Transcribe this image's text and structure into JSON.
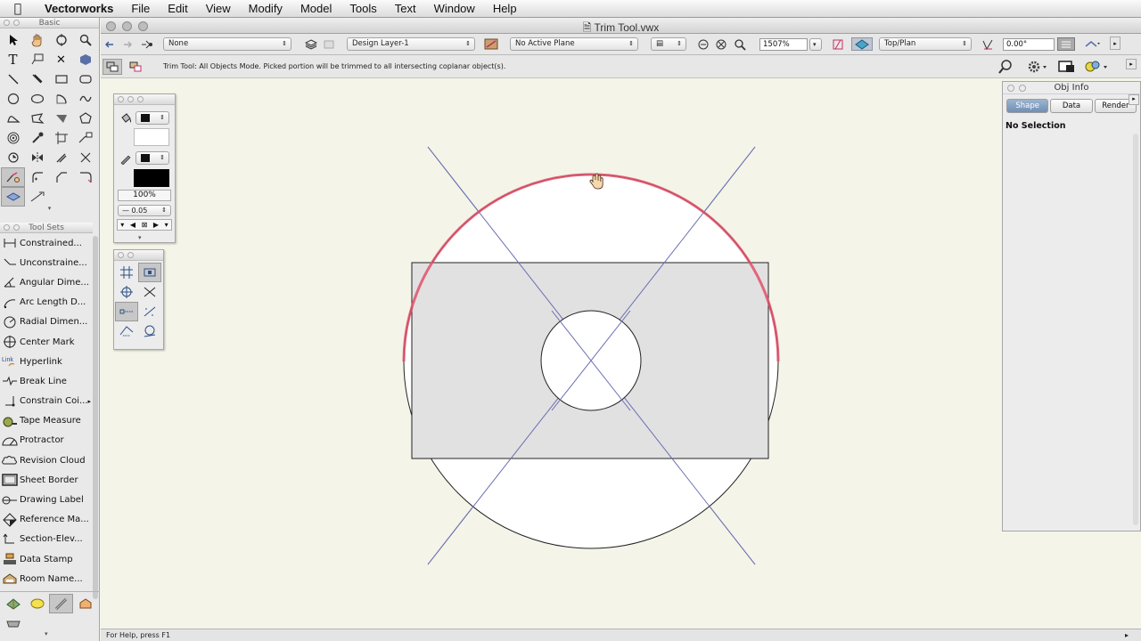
{
  "menubar": {
    "app": "Vectorworks",
    "items": [
      "File",
      "Edit",
      "View",
      "Modify",
      "Model",
      "Tools",
      "Text",
      "Window",
      "Help"
    ]
  },
  "palettes": {
    "basic_title": "Basic",
    "toolsets_title": "Tool Sets",
    "toolset_items": [
      {
        "label": "Constrained...",
        "icon": "constrained-dimension-icon"
      },
      {
        "label": "Unconstraine...",
        "icon": "unconstrained-dimension-icon"
      },
      {
        "label": "Angular Dime...",
        "icon": "angular-dimension-icon"
      },
      {
        "label": "Arc Length D...",
        "icon": "arc-length-icon"
      },
      {
        "label": "Radial Dimen...",
        "icon": "radial-dimension-icon"
      },
      {
        "label": "Center Mark",
        "icon": "center-mark-icon"
      },
      {
        "label": "Hyperlink",
        "icon": "hyperlink-icon",
        "icon_text": "Link"
      },
      {
        "label": "Break Line",
        "icon": "break-line-icon"
      },
      {
        "label": "Constrain Coi...",
        "icon": "constrain-coincident-icon",
        "submenu": true
      },
      {
        "label": "Tape Measure",
        "icon": "tape-measure-icon"
      },
      {
        "label": "Protractor",
        "icon": "protractor-icon"
      },
      {
        "label": "Revision Cloud",
        "icon": "revision-cloud-icon"
      },
      {
        "label": "Sheet Border",
        "icon": "sheet-border-icon"
      },
      {
        "label": "Drawing Label",
        "icon": "drawing-label-icon"
      },
      {
        "label": "Reference Ma...",
        "icon": "reference-marker-icon"
      },
      {
        "label": "Section-Elev...",
        "icon": "section-elevation-icon"
      },
      {
        "label": "Data Stamp",
        "icon": "data-stamp-icon"
      },
      {
        "label": "Room Name...",
        "icon": "room-name-icon"
      }
    ]
  },
  "document": {
    "title": "Trim Tool.vwx"
  },
  "viewbar": {
    "class_value": "None",
    "layer_value": "Design Layer-1",
    "plane_value": "No Active Plane",
    "zoom_value": "1507%",
    "view_value": "Top/Plan",
    "rotation_value": "0.00°"
  },
  "modebar": {
    "message": "Trim Tool: All Objects Mode. Picked portion will be trimmed to all intersecting coplanar object(s)."
  },
  "attributes": {
    "opacity": "100%",
    "line_weight": "0.05"
  },
  "objinfo": {
    "title": "Obj Info",
    "tabs": [
      "Shape",
      "Data",
      "Render"
    ],
    "active_tab": "Shape",
    "selection_text": "No Selection"
  },
  "status": {
    "text": "For Help, press F1"
  },
  "colors": {
    "highlight": "#e0506a",
    "construction_lines": "#6a6fb0",
    "rect_fill": "#e1e1e1",
    "canvas_bg": "#f4f4e8"
  }
}
